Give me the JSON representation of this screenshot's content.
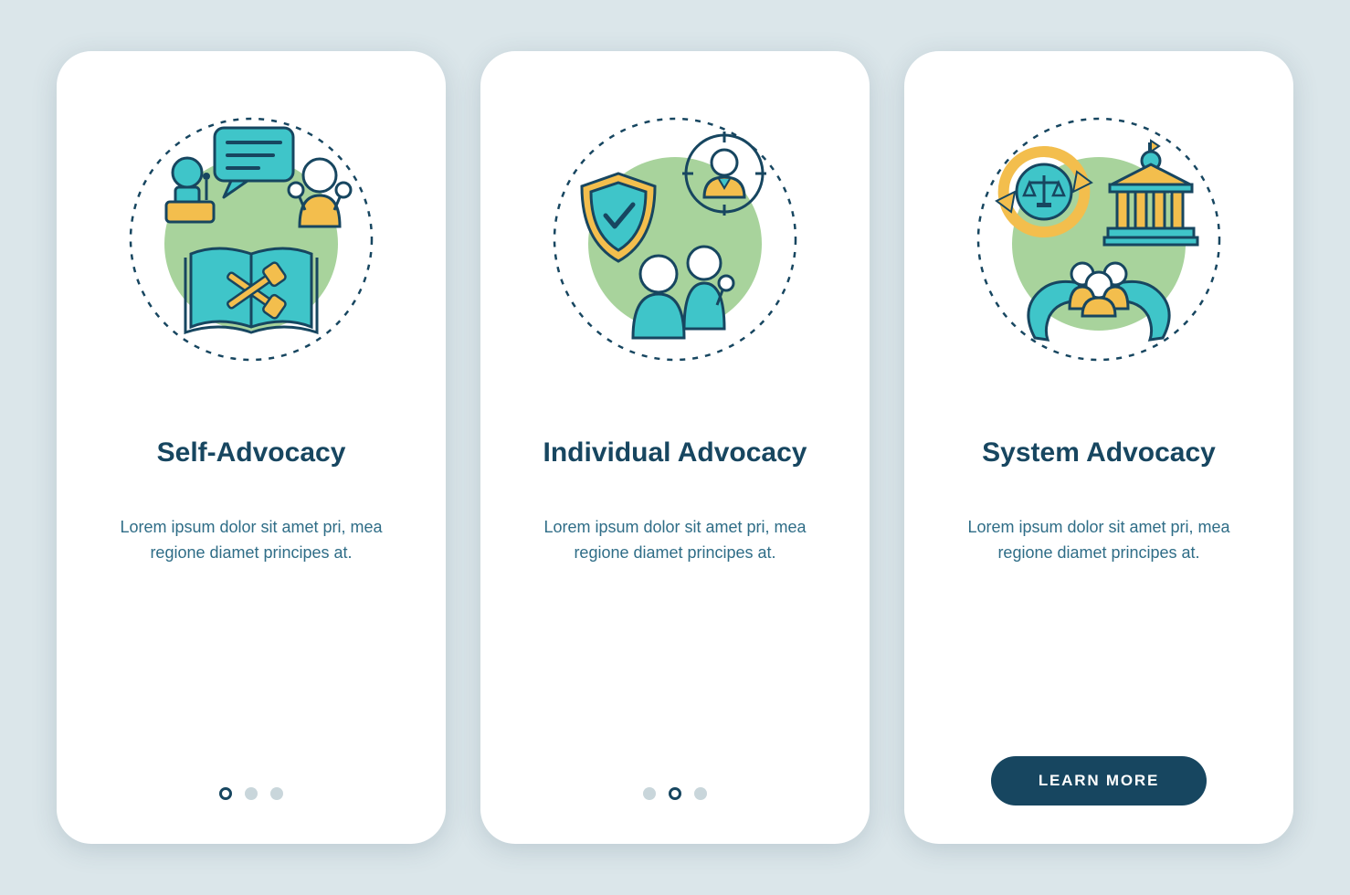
{
  "colors": {
    "bg": "#dbe6ea",
    "card": "#ffffff",
    "heading": "#174660",
    "body": "#2f6d87",
    "accent_teal": "#3fc5c9",
    "accent_yellow": "#f3be4d",
    "accent_green": "#a8d39c",
    "dot_inactive": "#c9d6db",
    "cta_bg": "#174660",
    "cta_text": "#ffffff"
  },
  "screens": [
    {
      "id": "self",
      "icon_name": "self-advocacy-illustration",
      "title": "Self-Advocacy",
      "body": "Lorem ipsum dolor sit amet pri, mea regione diamet principes at.",
      "active_dot": 0,
      "has_cta": false
    },
    {
      "id": "individual",
      "icon_name": "individual-advocacy-illustration",
      "title": "Individual Advocacy",
      "body": "Lorem ipsum dolor sit amet pri, mea regione diamet principes at.",
      "active_dot": 1,
      "has_cta": false
    },
    {
      "id": "system",
      "icon_name": "system-advocacy-illustration",
      "title": "System Advocacy",
      "body": "Lorem ipsum dolor sit amet pri, mea regione diamet principes at.",
      "active_dot": 2,
      "has_cta": true
    }
  ],
  "cta_label": "LEARN MORE",
  "dot_count": 3
}
